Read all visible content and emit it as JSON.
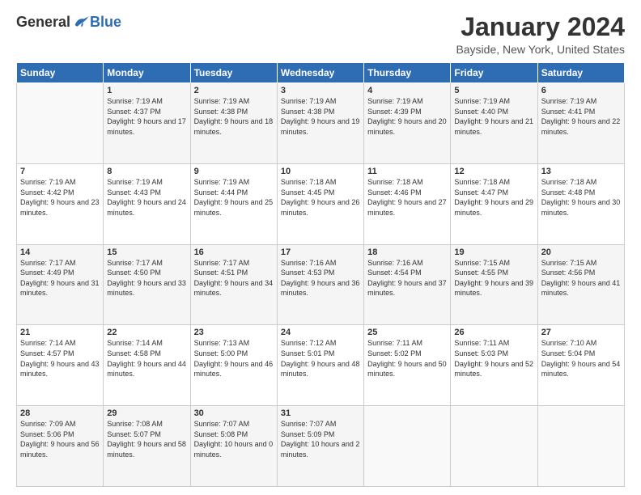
{
  "logo": {
    "general": "General",
    "blue": "Blue"
  },
  "header": {
    "title": "January 2024",
    "location": "Bayside, New York, United States"
  },
  "weekdays": [
    "Sunday",
    "Monday",
    "Tuesday",
    "Wednesday",
    "Thursday",
    "Friday",
    "Saturday"
  ],
  "weeks": [
    [
      {
        "day": "",
        "sunrise": "",
        "sunset": "",
        "daylight": ""
      },
      {
        "day": "1",
        "sunrise": "Sunrise: 7:19 AM",
        "sunset": "Sunset: 4:37 PM",
        "daylight": "Daylight: 9 hours and 17 minutes."
      },
      {
        "day": "2",
        "sunrise": "Sunrise: 7:19 AM",
        "sunset": "Sunset: 4:38 PM",
        "daylight": "Daylight: 9 hours and 18 minutes."
      },
      {
        "day": "3",
        "sunrise": "Sunrise: 7:19 AM",
        "sunset": "Sunset: 4:38 PM",
        "daylight": "Daylight: 9 hours and 19 minutes."
      },
      {
        "day": "4",
        "sunrise": "Sunrise: 7:19 AM",
        "sunset": "Sunset: 4:39 PM",
        "daylight": "Daylight: 9 hours and 20 minutes."
      },
      {
        "day": "5",
        "sunrise": "Sunrise: 7:19 AM",
        "sunset": "Sunset: 4:40 PM",
        "daylight": "Daylight: 9 hours and 21 minutes."
      },
      {
        "day": "6",
        "sunrise": "Sunrise: 7:19 AM",
        "sunset": "Sunset: 4:41 PM",
        "daylight": "Daylight: 9 hours and 22 minutes."
      }
    ],
    [
      {
        "day": "7",
        "sunrise": "Sunrise: 7:19 AM",
        "sunset": "Sunset: 4:42 PM",
        "daylight": "Daylight: 9 hours and 23 minutes."
      },
      {
        "day": "8",
        "sunrise": "Sunrise: 7:19 AM",
        "sunset": "Sunset: 4:43 PM",
        "daylight": "Daylight: 9 hours and 24 minutes."
      },
      {
        "day": "9",
        "sunrise": "Sunrise: 7:19 AM",
        "sunset": "Sunset: 4:44 PM",
        "daylight": "Daylight: 9 hours and 25 minutes."
      },
      {
        "day": "10",
        "sunrise": "Sunrise: 7:18 AM",
        "sunset": "Sunset: 4:45 PM",
        "daylight": "Daylight: 9 hours and 26 minutes."
      },
      {
        "day": "11",
        "sunrise": "Sunrise: 7:18 AM",
        "sunset": "Sunset: 4:46 PM",
        "daylight": "Daylight: 9 hours and 27 minutes."
      },
      {
        "day": "12",
        "sunrise": "Sunrise: 7:18 AM",
        "sunset": "Sunset: 4:47 PM",
        "daylight": "Daylight: 9 hours and 29 minutes."
      },
      {
        "day": "13",
        "sunrise": "Sunrise: 7:18 AM",
        "sunset": "Sunset: 4:48 PM",
        "daylight": "Daylight: 9 hours and 30 minutes."
      }
    ],
    [
      {
        "day": "14",
        "sunrise": "Sunrise: 7:17 AM",
        "sunset": "Sunset: 4:49 PM",
        "daylight": "Daylight: 9 hours and 31 minutes."
      },
      {
        "day": "15",
        "sunrise": "Sunrise: 7:17 AM",
        "sunset": "Sunset: 4:50 PM",
        "daylight": "Daylight: 9 hours and 33 minutes."
      },
      {
        "day": "16",
        "sunrise": "Sunrise: 7:17 AM",
        "sunset": "Sunset: 4:51 PM",
        "daylight": "Daylight: 9 hours and 34 minutes."
      },
      {
        "day": "17",
        "sunrise": "Sunrise: 7:16 AM",
        "sunset": "Sunset: 4:53 PM",
        "daylight": "Daylight: 9 hours and 36 minutes."
      },
      {
        "day": "18",
        "sunrise": "Sunrise: 7:16 AM",
        "sunset": "Sunset: 4:54 PM",
        "daylight": "Daylight: 9 hours and 37 minutes."
      },
      {
        "day": "19",
        "sunrise": "Sunrise: 7:15 AM",
        "sunset": "Sunset: 4:55 PM",
        "daylight": "Daylight: 9 hours and 39 minutes."
      },
      {
        "day": "20",
        "sunrise": "Sunrise: 7:15 AM",
        "sunset": "Sunset: 4:56 PM",
        "daylight": "Daylight: 9 hours and 41 minutes."
      }
    ],
    [
      {
        "day": "21",
        "sunrise": "Sunrise: 7:14 AM",
        "sunset": "Sunset: 4:57 PM",
        "daylight": "Daylight: 9 hours and 43 minutes."
      },
      {
        "day": "22",
        "sunrise": "Sunrise: 7:14 AM",
        "sunset": "Sunset: 4:58 PM",
        "daylight": "Daylight: 9 hours and 44 minutes."
      },
      {
        "day": "23",
        "sunrise": "Sunrise: 7:13 AM",
        "sunset": "Sunset: 5:00 PM",
        "daylight": "Daylight: 9 hours and 46 minutes."
      },
      {
        "day": "24",
        "sunrise": "Sunrise: 7:12 AM",
        "sunset": "Sunset: 5:01 PM",
        "daylight": "Daylight: 9 hours and 48 minutes."
      },
      {
        "day": "25",
        "sunrise": "Sunrise: 7:11 AM",
        "sunset": "Sunset: 5:02 PM",
        "daylight": "Daylight: 9 hours and 50 minutes."
      },
      {
        "day": "26",
        "sunrise": "Sunrise: 7:11 AM",
        "sunset": "Sunset: 5:03 PM",
        "daylight": "Daylight: 9 hours and 52 minutes."
      },
      {
        "day": "27",
        "sunrise": "Sunrise: 7:10 AM",
        "sunset": "Sunset: 5:04 PM",
        "daylight": "Daylight: 9 hours and 54 minutes."
      }
    ],
    [
      {
        "day": "28",
        "sunrise": "Sunrise: 7:09 AM",
        "sunset": "Sunset: 5:06 PM",
        "daylight": "Daylight: 9 hours and 56 minutes."
      },
      {
        "day": "29",
        "sunrise": "Sunrise: 7:08 AM",
        "sunset": "Sunset: 5:07 PM",
        "daylight": "Daylight: 9 hours and 58 minutes."
      },
      {
        "day": "30",
        "sunrise": "Sunrise: 7:07 AM",
        "sunset": "Sunset: 5:08 PM",
        "daylight": "Daylight: 10 hours and 0 minutes."
      },
      {
        "day": "31",
        "sunrise": "Sunrise: 7:07 AM",
        "sunset": "Sunset: 5:09 PM",
        "daylight": "Daylight: 10 hours and 2 minutes."
      },
      {
        "day": "",
        "sunrise": "",
        "sunset": "",
        "daylight": ""
      },
      {
        "day": "",
        "sunrise": "",
        "sunset": "",
        "daylight": ""
      },
      {
        "day": "",
        "sunrise": "",
        "sunset": "",
        "daylight": ""
      }
    ]
  ]
}
